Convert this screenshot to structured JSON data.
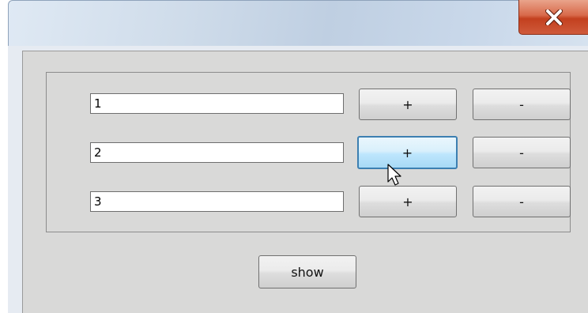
{
  "window": {
    "close_icon": "close-x-icon",
    "accent_colors": {
      "close_button": "#c3401f",
      "focus_border": "#3c7fb1",
      "client_bg": "#d9d9d8"
    }
  },
  "rows": [
    {
      "value": "1",
      "plus_label": "+",
      "minus_label": "-"
    },
    {
      "value": "2",
      "plus_label": "+",
      "minus_label": "-"
    },
    {
      "value": "3",
      "plus_label": "+",
      "minus_label": "-"
    }
  ],
  "show_label": "show",
  "cursor_icon": "mouse-pointer-icon"
}
